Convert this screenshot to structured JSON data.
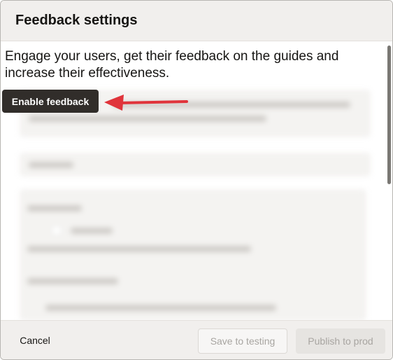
{
  "dialog": {
    "title": "Feedback settings",
    "intro": "Engage your users, get their feedback on the guides and increase their effectiveness.",
    "enable_button_label": "Enable feedback",
    "annotation": {
      "icon": "red-arrow-icon",
      "color": "#e0343b"
    }
  },
  "footer": {
    "cancel_label": "Cancel",
    "save_label": "Save to testing",
    "publish_label": "Publish to prod"
  },
  "colors": {
    "primary_button": "#312d2a",
    "header_background": "#f1efed",
    "disabled_text": "#a8a5a1"
  }
}
